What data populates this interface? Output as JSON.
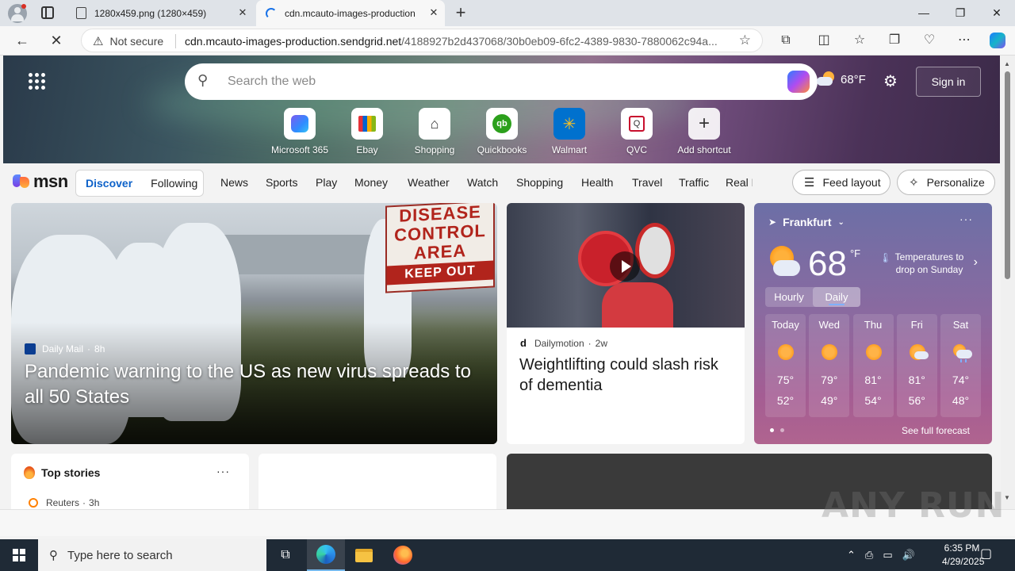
{
  "browser": {
    "tabs": [
      {
        "title": "1280x459.png (1280×459)",
        "active": false
      },
      {
        "title": "cdn.mcauto-images-production",
        "active": true
      }
    ],
    "new_tab_label": "+",
    "window_controls": {
      "minimize": "—",
      "maximize": "❐",
      "close": "✕"
    },
    "security_label": "Not secure",
    "url_domain": "cdn.mcauto-images-production.sendgrid.net",
    "url_path": "/4188927b2d437068/30b0eb09-6fc2-4389-9830-7880062c94a..."
  },
  "hero": {
    "search_placeholder": "Search the web",
    "weather_temp": "68°F",
    "sign_in": "Sign in",
    "shortcuts": [
      {
        "label": "Microsoft 365",
        "icon": "microsoft365-icon"
      },
      {
        "label": "Ebay",
        "icon": "ebay-icon"
      },
      {
        "label": "Shopping",
        "icon": "shopping-tag-icon"
      },
      {
        "label": "Quickbooks",
        "icon": "quickbooks-icon"
      },
      {
        "label": "Walmart",
        "icon": "walmart-icon"
      },
      {
        "label": "QVC",
        "icon": "qvc-icon"
      },
      {
        "label": "Add shortcut",
        "icon": "plus-icon"
      }
    ]
  },
  "msn_nav": {
    "logo": "msn",
    "segments": {
      "discover": "Discover",
      "following": "Following"
    },
    "links": [
      "News",
      "Sports",
      "Play",
      "Money",
      "Weather",
      "Watch",
      "Shopping",
      "Health",
      "Travel",
      "Traffic",
      "Real E"
    ],
    "feed_layout": "Feed layout",
    "personalize": "Personalize"
  },
  "main_story": {
    "source": "Daily Mail",
    "age": "8h",
    "title": "Pandemic warning to the US as new virus spreads to all 50 States",
    "sign_lines": [
      "DISEASE",
      "CONTROL",
      "AREA",
      "KEEP OUT"
    ]
  },
  "video_story": {
    "source_logo": "d",
    "source": "Dailymotion",
    "age": "2w",
    "title": "Weightlifting could slash risk of dementia"
  },
  "weather": {
    "location": "Frankfurt",
    "temp": "68",
    "unit": "°F",
    "alert": "Temperatures to drop on Sunday",
    "tabs": [
      "Hourly",
      "Daily"
    ],
    "active_tab": "Daily",
    "days": [
      {
        "name": "Today",
        "hi": "75°",
        "lo": "52°",
        "icon": "sunny-icon"
      },
      {
        "name": "Wed",
        "hi": "79°",
        "lo": "49°",
        "icon": "sunny-icon"
      },
      {
        "name": "Thu",
        "hi": "81°",
        "lo": "54°",
        "icon": "sunny-icon"
      },
      {
        "name": "Fri",
        "hi": "81°",
        "lo": "56°",
        "icon": "partly-cloudy-icon"
      },
      {
        "name": "Sat",
        "hi": "74°",
        "lo": "48°",
        "icon": "rain-cloud-icon"
      }
    ],
    "see_full": "See full forecast"
  },
  "top_stories": {
    "title": "Top stories",
    "first_source": "Reuters",
    "first_age": "3h"
  },
  "watermark": "ANY RUN",
  "taskbar": {
    "search_placeholder": "Type here to search",
    "time": "6:35 PM",
    "date": "4/29/2025"
  }
}
